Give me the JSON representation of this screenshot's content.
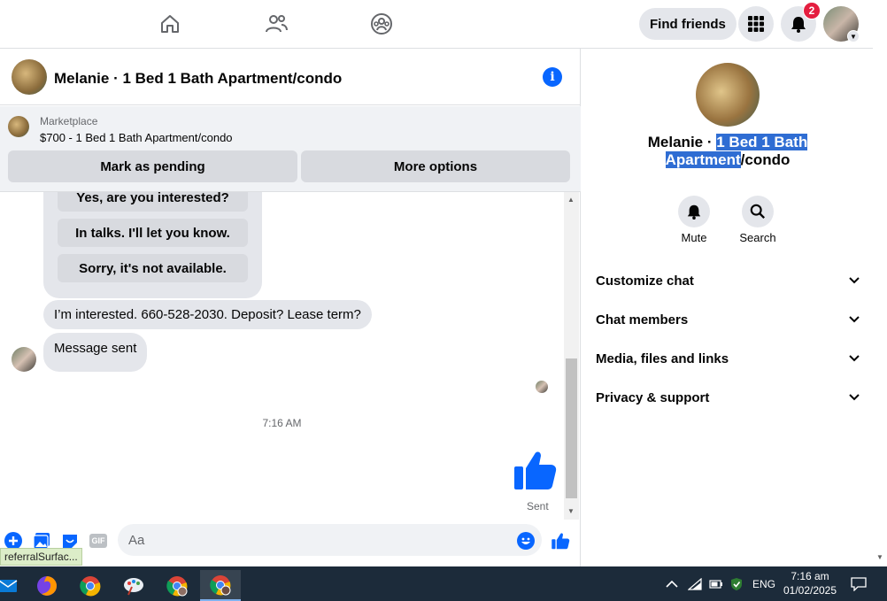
{
  "topnav": {
    "find_friends": "Find friends",
    "notification_count": "2"
  },
  "chat": {
    "title": "Melanie · 1 Bed 1 Bath Apartment/condo",
    "marketplace_label": "Marketplace",
    "listing": "$700 - 1 Bed 1 Bath Apartment/condo",
    "mark_pending": "Mark as pending",
    "more_options": "More options"
  },
  "messages": {
    "quick_replies": [
      "Yes, are you interested?",
      "In talks. I'll let you know.",
      "Sorry, it's not available."
    ],
    "incoming_1": "I’m interested.  660-528-2030. Deposit? Lease term?",
    "incoming_2": "Message sent",
    "timestamp": "7:16 AM",
    "sent_label": "Sent"
  },
  "composer": {
    "placeholder": "Aa",
    "gif_label": "GIF",
    "tooltip": "referralSurfac..."
  },
  "side": {
    "title_name": "Melanie · ",
    "title_highlight": "1 Bed 1 Bath Apartment",
    "title_rest": "/condo",
    "mute": "Mute",
    "search": "Search",
    "sections": [
      "Customize chat",
      "Chat members",
      "Media, files and links",
      "Privacy & support"
    ]
  },
  "taskbar": {
    "language": "ENG",
    "time": "7:16 am",
    "date": "01/02/2025"
  },
  "colors": {
    "accent": "#0866ff",
    "badge": "#e41e3f",
    "highlight": "#2f6dd3",
    "taskbar": "#1c2b3a"
  }
}
